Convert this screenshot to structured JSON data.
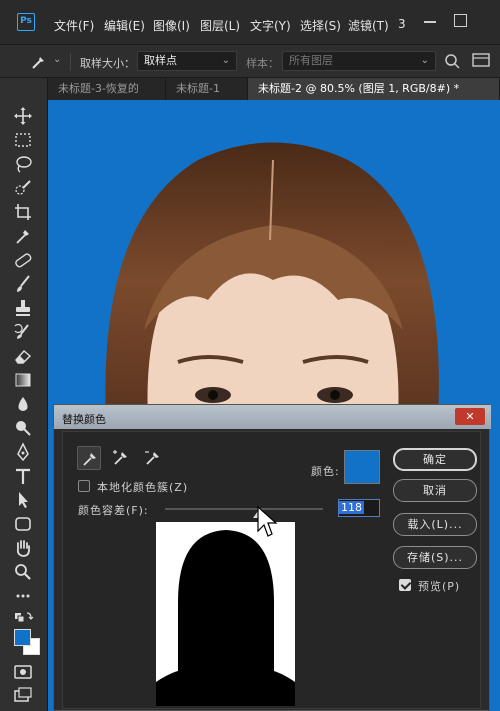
{
  "app": {
    "logo": "Ps"
  },
  "menu": [
    "文件(F)",
    "编辑(E)",
    "图像(I)",
    "图层(L)",
    "文字(Y)",
    "选择(S)",
    "滤镜(T)",
    "3"
  ],
  "options": {
    "sample_size_label": "取样大小：",
    "sample_size_value": "取样点",
    "sample_label": "样本：",
    "sample_value": "所有图层"
  },
  "tabs": [
    "未标题-3-恢复的",
    "未标题-1",
    "未标题-2 @ 80.5% (图层 1, RGB/8#) *"
  ],
  "tools": [
    "move-tool",
    "marquee-tool",
    "lasso-tool",
    "quick-select-tool",
    "crop-tool",
    "eyedropper-tool",
    "healing-brush-tool",
    "brush-tool",
    "clone-stamp-tool",
    "history-brush-tool",
    "eraser-tool",
    "gradient-tool",
    "blur-tool",
    "dodge-tool",
    "pen-tool",
    "type-tool",
    "path-select-tool",
    "shape-tool",
    "hand-tool",
    "zoom-tool",
    "more-tools"
  ],
  "colors": {
    "foreground": "#1272c8",
    "background": "#ffffff",
    "canvas_bg": "#1272c8"
  },
  "dialog": {
    "title": "替换颜色",
    "close": "✕",
    "localized_label": "本地化颜色簇(Z)",
    "localized_checked": false,
    "color_label": "颜色:",
    "swatch_color": "#1272c8",
    "fuzziness_label": "颜色容差(F):",
    "fuzziness_value": "118",
    "fuzziness_max": 200,
    "buttons": {
      "ok": "确定",
      "cancel": "取消",
      "load": "载入(L)...",
      "save": "存储(S)..."
    },
    "preview_label": "预览(P)",
    "preview_checked": true
  }
}
